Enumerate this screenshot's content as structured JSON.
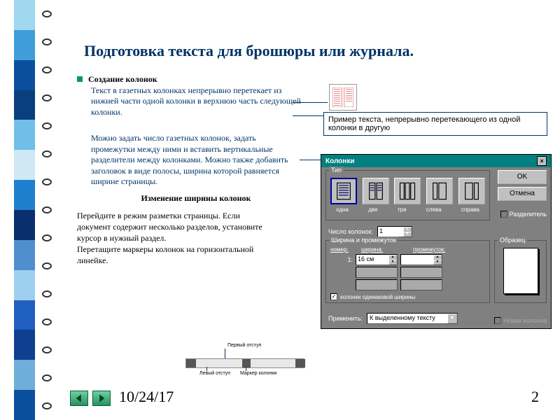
{
  "title": "Подготовка текста для брошюры или журнала.",
  "bullet_title": "Создание колонок",
  "para1": "Текст в газетных колонках непрерывно перетекает из нижней части одной колонки в верхнюю часть следующей колонки.",
  "para2": "Можно задать число газетных колонок, задать промежутки между ними и вставить вертикальные разделители между колонками. Можно также добавить заголовок в виде полосы, ширина которой равняется ширине страницы.",
  "subhead": "Изменение ширины колонок",
  "para3": "Перейдите в режим разметки страницы. Если документ содержит несколько разделов, установите курсор в нужный раздел.\nПеретащите маркеры колонок на горизонтальной линейке.",
  "callout": "Пример текста, непрерывно перетекающего из одной колонки в другую",
  "dialog": {
    "title": "Колонки",
    "type_label": "Тип",
    "types": [
      "одна",
      "две",
      "три",
      "слева",
      "справа"
    ],
    "ok": "OK",
    "cancel": "Отмена",
    "divider": "Разделитель",
    "num_label": "Число колонок:",
    "num_value": "1",
    "width_group": "Ширина и промежуток",
    "head_num": "номер:",
    "head_width": "ширина:",
    "head_gap": "промежуток:",
    "row1_num": "1:",
    "row1_width": "16 см",
    "equal": "колонки одинаковой ширины",
    "sample": "Образец",
    "apply_label": "Применить:",
    "apply_value": "К выделенному тексту",
    "newcol": "Новая колонка"
  },
  "ruler": {
    "first_indent": "Первый отступ",
    "left_indent": "Левый отступ",
    "col_marker": "Маркер колонки"
  },
  "footer": {
    "date": "10/24/17",
    "page": "2"
  },
  "strip_colors": [
    "#9fd8ef",
    "#3f9ed8",
    "#0a4f9e",
    "#0a3f7e",
    "#6fbfe8",
    "#cfe8f4",
    "#1f7fcf",
    "#0a2f6e",
    "#4f8fcf",
    "#9fcfef",
    "#1f5fbf",
    "#0f3f8f",
    "#6faed8",
    "#0a4f9e"
  ]
}
